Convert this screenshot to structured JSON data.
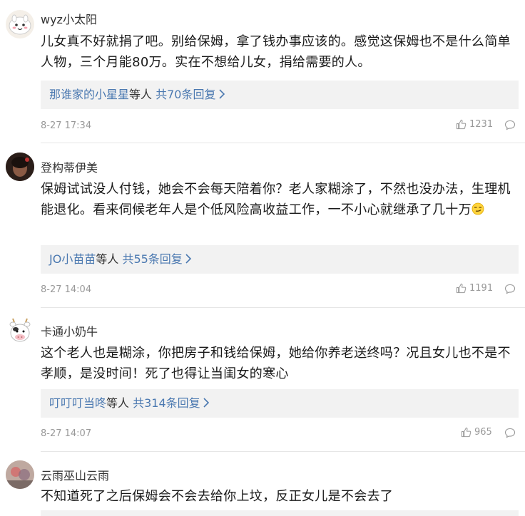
{
  "comments": [
    {
      "username": "wyz小太阳",
      "content": "儿女真不好就捐了吧。别给保姆，拿了钱办事应该的。感觉这保姆也不是什么简单人物，三个月能80万。实在不想给儿女，捐给需要的人。",
      "reply_user": "那谁家的小星星",
      "reply_mid": "等人",
      "reply_count": "共70条回复",
      "time": "8-27 17:34",
      "likes": "1231"
    },
    {
      "username": "登构蒂伊美",
      "content": "保姆试试没人付钱，她会不会每天陪着你？老人家糊涂了，不然也没办法，生理机能退化。看来伺候老年人是个低风险高收益工作，一不小心就继承了几十万",
      "reply_user": "JO小苗苗",
      "reply_mid": "等人",
      "reply_count": "共55条回复",
      "time": "8-27 14:04",
      "likes": "1191"
    },
    {
      "username": "卡通小奶牛",
      "content": "这个老人也是糊涂，你把房子和钱给保姆，她给你养老送终吗？况且女儿也不是不孝顺，是没时间！死了也得让当闺女的寒心",
      "reply_user": "叮叮叮当咚",
      "reply_mid": "等人",
      "reply_count": "共314条回复",
      "time": "8-27 14:07",
      "likes": "965"
    },
    {
      "username": "云雨巫山云雨",
      "content": "不知道死了之后保姆会不会去给你上坟，反正女儿是不会去了"
    }
  ],
  "icons": {
    "like": "thumbs-up-icon",
    "reply": "speech-bubble-icon",
    "chevron": "chevron-right-icon",
    "emoji": "smirk-emoji-icon"
  },
  "colors": {
    "link_blue": "#4a78b0",
    "meta_grey": "#999999",
    "reply_bg": "#f2f2f2"
  }
}
